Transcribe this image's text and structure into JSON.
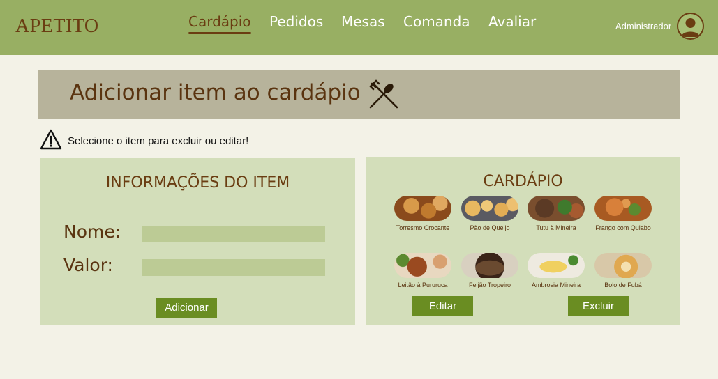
{
  "header": {
    "logo": "APETITO",
    "nav": [
      {
        "label": "Cardápio",
        "active": true
      },
      {
        "label": "Pedidos",
        "active": false
      },
      {
        "label": "Mesas",
        "active": false
      },
      {
        "label": "Comanda",
        "active": false
      },
      {
        "label": "Avaliar",
        "active": false
      }
    ],
    "user": "Administrador",
    "avatar_icon": "user-avatar-icon"
  },
  "page": {
    "title": "Adicionar item ao cardápio",
    "title_icon": "fork-knife-icon",
    "notice": "Selecione o item para excluir ou editar!",
    "notice_icon": "warning-icon"
  },
  "item_form": {
    "title": "INFORMAÇÕES DO ITEM",
    "name_label": "Nome:",
    "name_value": "",
    "price_label": "Valor:",
    "price_value": "",
    "add_button": "Adicionar"
  },
  "menu": {
    "title": "CARDÁPIO",
    "items": [
      {
        "name": "Torresmo Crocante"
      },
      {
        "name": "Pão de Queijo"
      },
      {
        "name": "Tutu à Mineira"
      },
      {
        "name": "Frango com Quiabo"
      },
      {
        "name": "Leitão à Pururuca"
      },
      {
        "name": "Feijão Tropeiro"
      },
      {
        "name": "Ambrosia Mineira"
      },
      {
        "name": "Bolo de Fubá"
      }
    ],
    "edit_button": "Editar",
    "delete_button": "Excluir"
  },
  "colors": {
    "header_bg": "#98af63",
    "brand_brown": "#6a3d12",
    "title_band": "#b7b39b",
    "panel_bg": "#d3deba",
    "input_bg": "#bccb95",
    "button_bg": "#6a8d22",
    "page_bg": "#f3f2e7"
  }
}
